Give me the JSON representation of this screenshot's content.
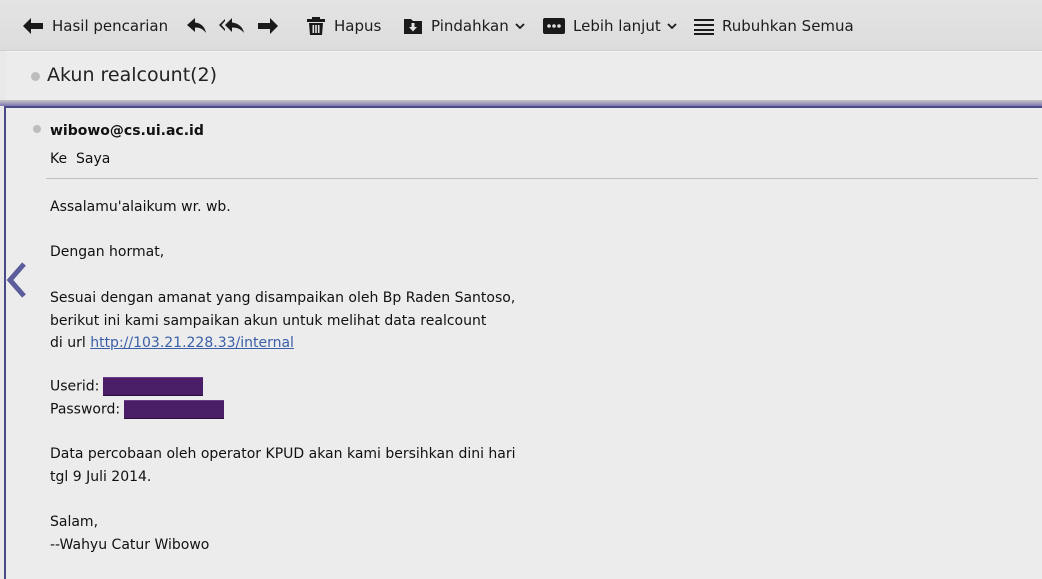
{
  "toolbar": {
    "back_label": "Hasil pencarian",
    "delete_label": "Hapus",
    "move_label": "Pindahkan",
    "more_label": "Lebih lanjut",
    "collapse_label": "Rubuhkan Semua"
  },
  "subject": {
    "title": "Akun realcount(2)"
  },
  "message": {
    "sender": "wibowo@cs.ui.ac.id",
    "recipient": "Ke  Saya",
    "greeting": "Assalamu'alaikum wr. wb.",
    "salutation": "Dengan hormat,",
    "para1_line1": "Sesuai dengan amanat yang disampaikan oleh Bp Raden Santoso,",
    "para1_line2": "berikut ini kami sampaikan akun untuk melihat data realcount",
    "para1_line3_prefix": "di url ",
    "link": "http://103.21.228.33/internal",
    "userid_label": "Userid:",
    "password_label": "Password:",
    "para2_line1": "Data percobaan oleh operator KPUD akan kami bersihkan dini hari",
    "para2_line2": "tgl 9 Juli 2014.",
    "closing": "Salam,",
    "signature": "--Wahyu Catur Wibowo"
  },
  "colors": {
    "accent": "#4b4a88",
    "redaction": "#4a1d67",
    "link": "#3a5fa8"
  },
  "icons": {
    "back": "arrow-left-icon",
    "reply": "reply-icon",
    "reply_all": "reply-all-icon",
    "forward": "forward-icon",
    "delete": "trash-icon",
    "move": "move-to-folder-icon",
    "more": "more-dots-icon",
    "collapse": "list-lines-icon",
    "prev_message": "chevron-left-icon"
  }
}
